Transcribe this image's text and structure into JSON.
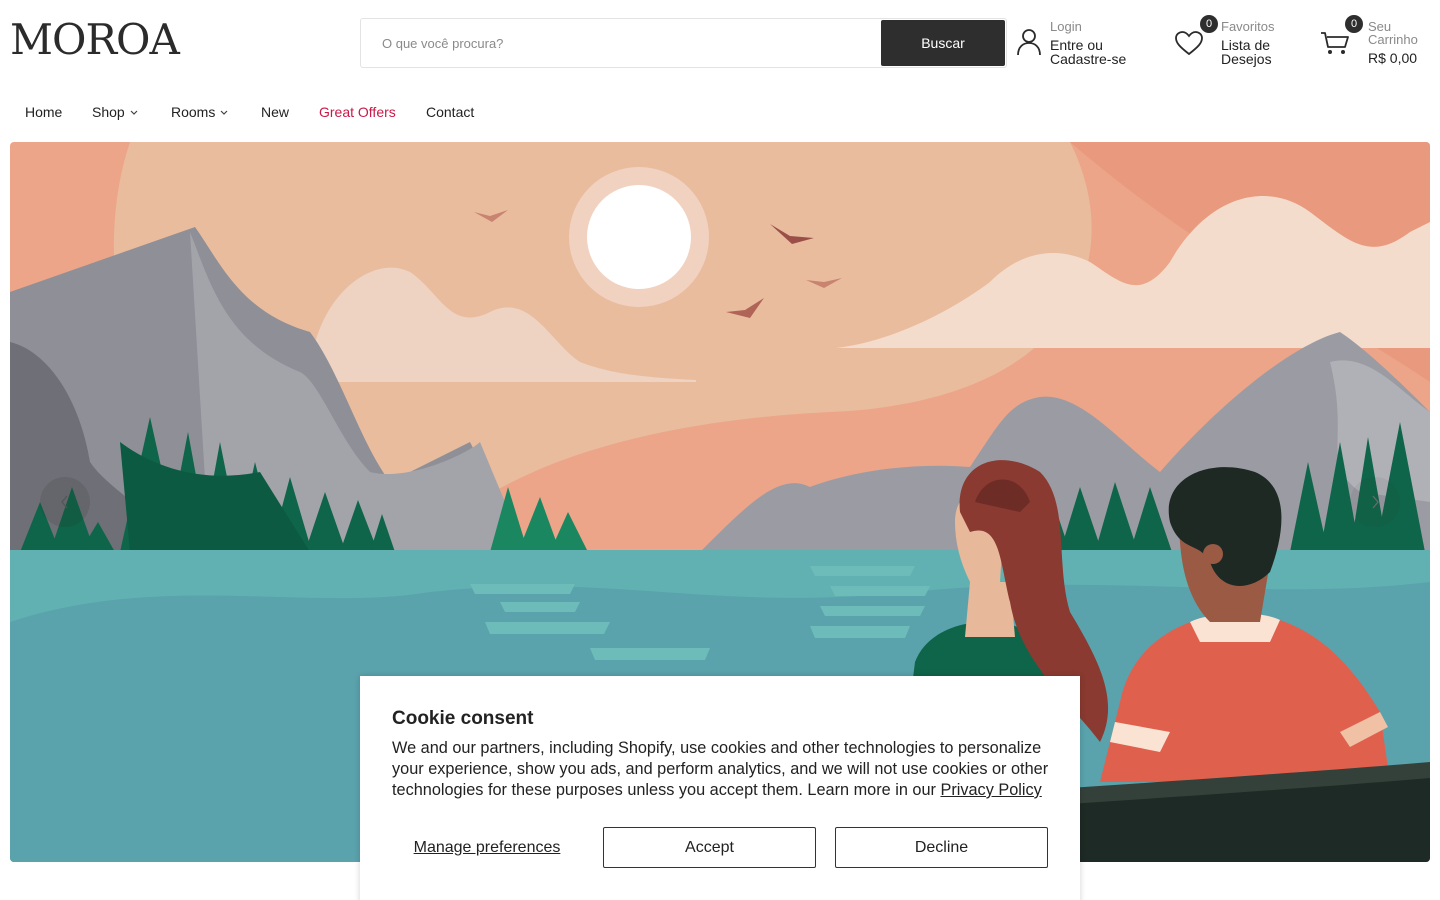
{
  "brand": {
    "logo": "MOROA"
  },
  "search": {
    "placeholder": "O que você procura?",
    "button_label": "Buscar"
  },
  "account": {
    "small_label": "Login",
    "main_label_line1": "Entre ou",
    "main_label_line2": "Cadastre-se",
    "icon": "user-icon"
  },
  "wishlist": {
    "count": "0",
    "small_label": "Favoritos",
    "main_label_line1": "Lista de",
    "main_label_line2": "Desejos",
    "icon": "heart-icon"
  },
  "cart": {
    "count": "0",
    "small_label_line1": "Seu",
    "small_label_line2": "Carrinho",
    "total": "R$ 0,00",
    "icon": "cart-icon"
  },
  "nav": {
    "items": [
      {
        "label": "Home"
      },
      {
        "label": "Shop",
        "has_dropdown": true
      },
      {
        "label": "Rooms",
        "has_dropdown": true
      },
      {
        "label": "New"
      },
      {
        "label": "Great Offers",
        "highlight": true
      },
      {
        "label": "Contact"
      }
    ]
  },
  "hero": {
    "prev_icon": "chevron-left-icon",
    "next_icon": "chevron-right-icon"
  },
  "cookie": {
    "title": "Cookie consent",
    "text": "We and our partners, including Shopify, use cookies and other technologies to personalize your experience, show you ads, and perform analytics, and we will not use cookies or other technologies for these purposes unless you accept them. Learn more in our ",
    "link_label": "Privacy Policy",
    "manage_label": "Manage preferences",
    "accept_label": "Accept",
    "decline_label": "Decline"
  },
  "colors": {
    "accent": "#c8194a",
    "button_dark": "#2e2e2e",
    "sky": "#e9b99b",
    "lake": "#5ea8ad"
  }
}
